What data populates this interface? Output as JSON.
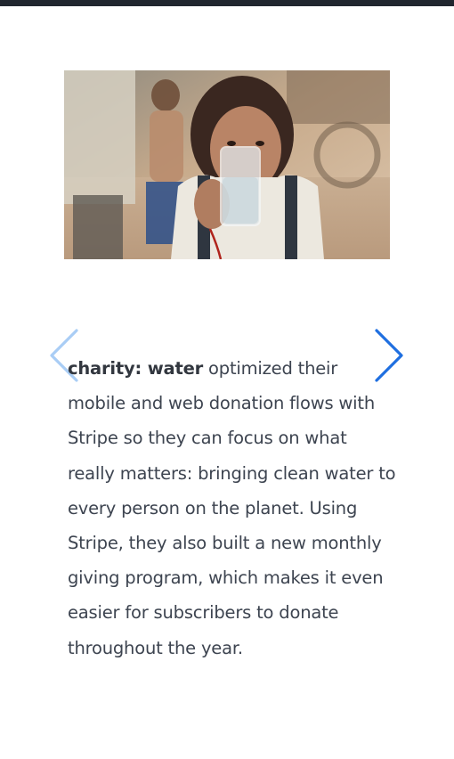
{
  "hero_image": {
    "alt": "Girl drinking a glass of clean water"
  },
  "carousel": {
    "prev_icon": "chevron-left-icon",
    "next_icon": "chevron-right-icon",
    "prev_color": "#a9cdf5",
    "next_color": "#1f6fe0"
  },
  "story": {
    "brand": "charity: water",
    "body": " optimized their mobile and web donation flows with Stripe so they can focus on what really matters: bringing clean water to every person on the planet. Using Stripe, they also built a new monthly giving program, which makes it even easier for subscribers to donate throughout the year."
  },
  "colors": {
    "topbar": "#21262f",
    "text": "#3d4450"
  }
}
